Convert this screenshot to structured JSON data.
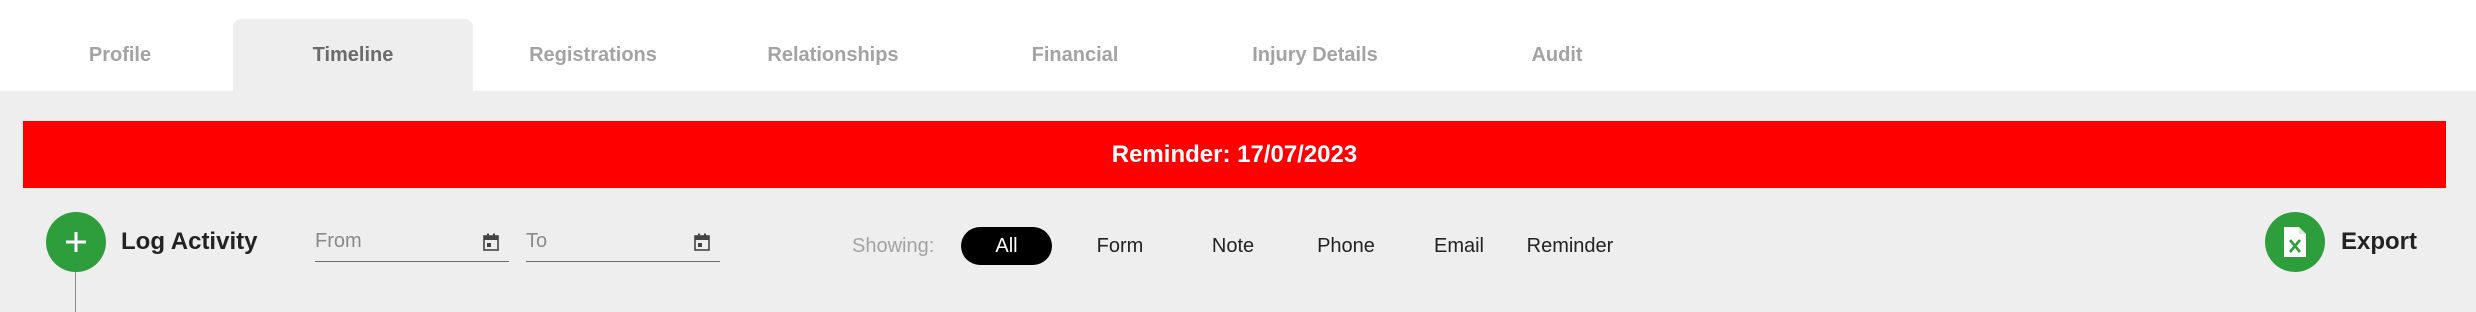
{
  "tabs": [
    {
      "label": "Profile"
    },
    {
      "label": "Timeline",
      "active": true
    },
    {
      "label": "Registrations"
    },
    {
      "label": "Relationships"
    },
    {
      "label": "Financial"
    },
    {
      "label": "Injury Details"
    },
    {
      "label": "Audit"
    }
  ],
  "banner": {
    "text": "Reminder: 17/07/2023",
    "color": "#ff0000"
  },
  "actions": {
    "log_activity": {
      "label": "Log Activity",
      "icon": "plus-icon"
    },
    "export": {
      "label": "Export",
      "icon": "excel-file-icon"
    }
  },
  "date_range": {
    "from": {
      "placeholder": "From",
      "value": "",
      "icon": "calendar-icon"
    },
    "to": {
      "placeholder": "To",
      "value": "",
      "icon": "calendar-icon"
    }
  },
  "filters": {
    "label": "Showing:",
    "options": [
      "All",
      "Form",
      "Note",
      "Phone",
      "Email",
      "Reminder"
    ],
    "selected": "All"
  },
  "colors": {
    "accent_green": "#2e9e3c",
    "panel_bg": "#eeeeee",
    "active_chip": "#000000"
  }
}
